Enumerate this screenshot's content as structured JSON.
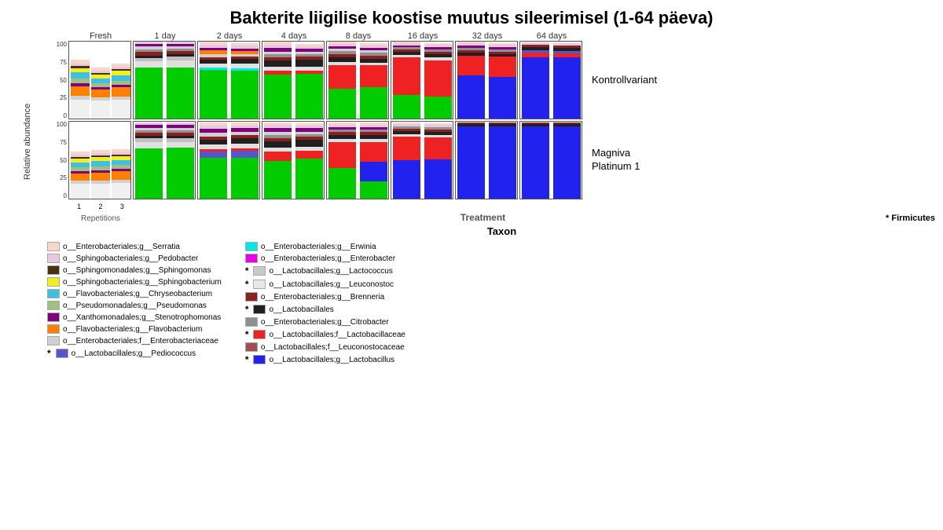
{
  "title": "Bakterite liigilise koostise muutus sileerimisel (1-64 päeva)",
  "yAxisLabel": "Relative abundance",
  "timeLabels": [
    "Fresh",
    "1 day",
    "2 days",
    "4 days",
    "8 days",
    "16 days",
    "32 days",
    "64 days"
  ],
  "rowLabels": [
    "Kontrollvariant",
    "Magniva\nPlatinum 1"
  ],
  "xAxisLabel": "Treatment",
  "bottomAxisLabel": "Taxon",
  "firmiLabel": "* Firmicutes",
  "repetitionsLabel": "Repetitions",
  "legend": [
    {
      "col": 0,
      "star": false,
      "color": "#f8d7c8",
      "text": "o__Enterobacteriales;g__Serratia"
    },
    {
      "col": 0,
      "star": false,
      "color": "#e8c8e0",
      "text": "o__Sphingobacteriales;g__Pedobacter"
    },
    {
      "col": 0,
      "star": false,
      "color": "#4a3010",
      "text": "o__Sphingomonadales;g__Sphingomonas"
    },
    {
      "col": 0,
      "star": false,
      "color": "#f0f020",
      "text": "o__Sphingobacteriales;g__Sphingobacterium"
    },
    {
      "col": 0,
      "star": false,
      "color": "#40c0e0",
      "text": "o__Flavobacteriales;g__Chryseobacterium"
    },
    {
      "col": 0,
      "star": false,
      "color": "#a0c080",
      "text": "o__Pseudomonadales;g__Pseudomonas"
    },
    {
      "col": 0,
      "star": false,
      "color": "#800080",
      "text": "o__Xanthomonadales;g__Stenotrophomonas"
    },
    {
      "col": 0,
      "star": false,
      "color": "#ff8000",
      "text": "o__Flavobacteriales;g__Flavobacterium"
    },
    {
      "col": 0,
      "star": false,
      "color": "#d0d0d0",
      "text": "o__Enterobacteriales;f__Enterobacteriaceae"
    },
    {
      "col": 0,
      "star": true,
      "color": "#5555cc",
      "text": "o__Lactobacillales;g__Pediococcus"
    },
    {
      "col": 1,
      "star": false,
      "color": "#00e8e8",
      "text": "o__Enterobacteriales;g__Erwinia"
    },
    {
      "col": 1,
      "star": false,
      "color": "#e800e8",
      "text": "o__Enterobacteriales;g__Enterobacter"
    },
    {
      "col": 1,
      "star": true,
      "color": "#c0c0c0",
      "text": "o__Lactobacillales;g__Lactococcus"
    },
    {
      "col": 1,
      "star": true,
      "color": "#e0e0e0",
      "text": "o__Lactobacillales;g__Leuconostoc"
    },
    {
      "col": 1,
      "star": false,
      "color": "#8b2020",
      "text": "o__Enterobacteriales;g__Brenneria"
    },
    {
      "col": 1,
      "star": true,
      "color": "#202020",
      "text": "o__Lactobacillales"
    },
    {
      "col": 1,
      "star": false,
      "color": "#909090",
      "text": "o__Enterobacteriales;g__Citrobacter"
    },
    {
      "col": 1,
      "star": true,
      "color": "#ee2222",
      "text": "o__Lactobacillales;f__Lactobacillaceae"
    },
    {
      "col": 1,
      "star": false,
      "color": "#a05050",
      "text": "o__Lactobacillales;f__Leuconostocaceae"
    },
    {
      "col": 1,
      "star": true,
      "color": "#2222ee",
      "text": "o__Lactobacillales;g__Lactobacillus"
    }
  ]
}
